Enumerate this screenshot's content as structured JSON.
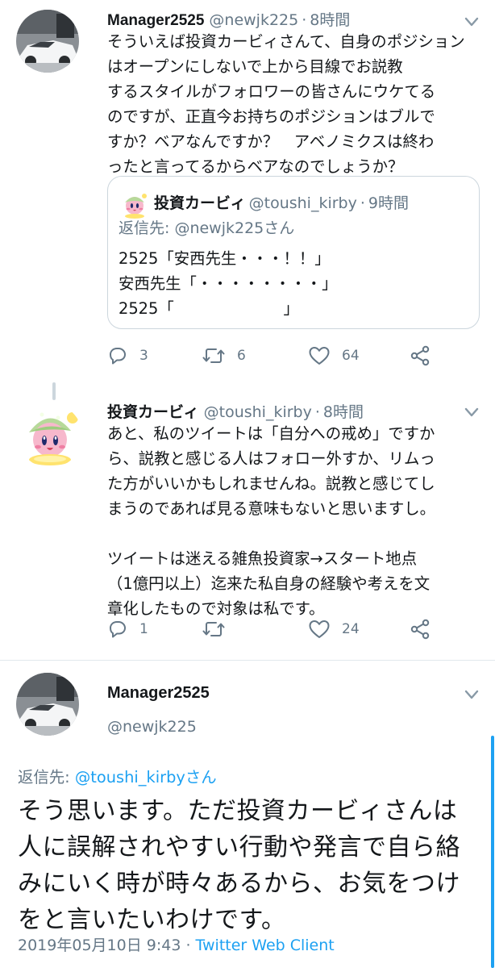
{
  "tweets": [
    {
      "name": "Manager2525",
      "handle": "@newjk225",
      "time": "8時間",
      "text": "そういえば投資カービィさんて、自身のポジション\nはオープンにしないで上から目線でお説教\nするスタイルがフォロワーの皆さんにウケてる\nのですが、正直今お持ちのポジションはブルで\nすか？ベアなんですか？　アベノミクスは終わ\nったと言ってるからベアなのでしょうか？",
      "quote": {
        "name": "投資カービィ",
        "handle": "@toushi_kirby",
        "time": "9時間",
        "reply_to": "返信先: @newjk225さん",
        "text": "2525「安西先生・・・！！」\n安西先生「・・・・・・・・」\n2525「　　　　　　　」"
      },
      "actions": {
        "reply": "3",
        "retweet": "6",
        "like": "64"
      }
    },
    {
      "name": "投資カービィ",
      "handle": "@toushi_kirby",
      "time": "8時間",
      "text": "あと、私のツイートは「自分への戒め」ですか\nら、説教と感じる人はフォロー外すか、リムっ\nた方がいいかもしれませんね。説教と感じてし\nまうのであれば見る意味もないと思いますし。\n\nツイートは迷える雑魚投資家→スタート地点\n（1億円以上）迄来た私自身の経験や考えを文\n章化したもので対象は私です。",
      "actions": {
        "reply": "1",
        "retweet": "",
        "like": "24"
      }
    }
  ],
  "main_tweet": {
    "name": "Manager2525",
    "handle": "@newjk225",
    "reply_prefix": "返信先: ",
    "reply_user": "@toushi_kirby",
    "reply_suffix": "さん",
    "text": "そう思います。ただ投資カービィさんは\n人に誤解されやすい行動や発言で自ら絡\nみにいく時が時々あるから、お気をつけ\nをと言いたいわけです。",
    "timestamp": "2019年05月10日 9:43 · ",
    "client": "Twitter Web Client"
  },
  "colors": {
    "text": "#14171a",
    "secondary": "#657786",
    "link": "#1da1f2",
    "border": "#ccd6dd"
  },
  "icons": [
    "reply-icon",
    "retweet-icon",
    "like-icon",
    "share-icon",
    "caret-down-icon"
  ]
}
